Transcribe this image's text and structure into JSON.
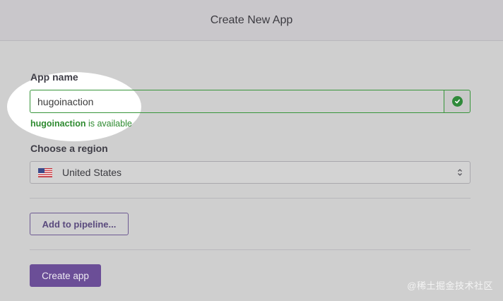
{
  "header": {
    "title": "Create New App"
  },
  "form": {
    "app_name_label": "App name",
    "app_name_value": "hugoinaction",
    "availability": {
      "name": "hugoinaction",
      "message": "is available"
    },
    "region_label": "Choose a region",
    "region_value": "United States",
    "region_icon": "us-flag-icon"
  },
  "actions": {
    "pipeline_label": "Add to pipeline...",
    "create_label": "Create app"
  },
  "watermark": "@稀土掘金技术社区",
  "colors": {
    "success": "#37953a",
    "primary": "#6b4e97",
    "secondary_border": "#6e5a92"
  }
}
